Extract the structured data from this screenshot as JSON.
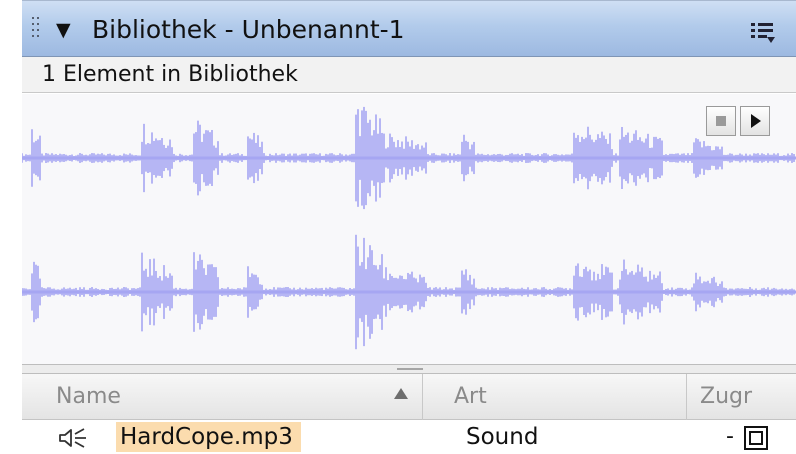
{
  "panel": {
    "title": "Bibliothek - Unbenannt-1",
    "collapse_icon": "triangle-down-icon",
    "menu_icon": "panel-options-menu-icon"
  },
  "status": {
    "text": "1 Element in Bibliothek"
  },
  "preview": {
    "waveform_color": "#a6a6f2",
    "channels": 2,
    "stop_icon": "stop-icon",
    "play_icon": "play-icon"
  },
  "table": {
    "columns": [
      "Name",
      "Art",
      "Zugr"
    ],
    "sorted_column": "Name",
    "rows": [
      {
        "name": "HardCope.mp3",
        "type": "Sound",
        "access": "-",
        "icon": "speaker-icon"
      }
    ]
  },
  "colors": {
    "titlebar": "#b2cbeb",
    "selection": "#fbdcae",
    "waveform": "#a6a6f2"
  }
}
